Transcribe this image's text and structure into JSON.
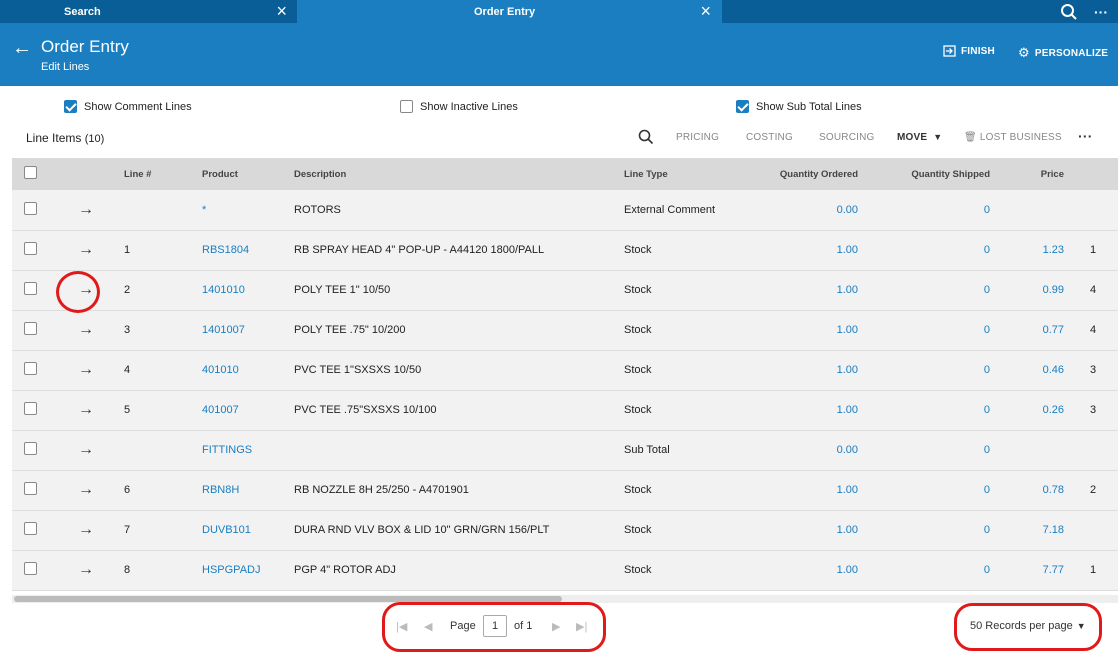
{
  "tabs": [
    {
      "label": "Search"
    },
    {
      "label": "Order Entry"
    }
  ],
  "header": {
    "title": "Order Entry",
    "subtitle": "Edit Lines",
    "finish_label": "FINISH",
    "personalize_label": "PERSONALIZE"
  },
  "options": {
    "comment": {
      "label": "Show Comment Lines",
      "checked": true
    },
    "inactive": {
      "label": "Show Inactive Lines",
      "checked": false
    },
    "subtotal": {
      "label": "Show Sub Total Lines",
      "checked": true
    }
  },
  "toolbar": {
    "title": "Line Items",
    "count": "(10)",
    "pricing": "PRICING",
    "costing": "COSTING",
    "sourcing": "SOURCING",
    "move": "MOVE",
    "lost_business": "LOST BUSINESS"
  },
  "columns": {
    "line": "Line #",
    "product": "Product",
    "description": "Description",
    "line_type": "Line Type",
    "qty_ordered": "Quantity Ordered",
    "qty_shipped": "Quantity Shipped",
    "price": "Price"
  },
  "rows": [
    {
      "line": "",
      "product": "*",
      "description": "ROTORS",
      "line_type": "External Comment",
      "qty_ordered": "0.00",
      "qty_shipped": "0",
      "price": "",
      "extra": ""
    },
    {
      "line": "1",
      "product": "RBS1804",
      "description": "RB SPRAY HEAD 4\" POP-UP - A44120 1800/PALL",
      "line_type": "Stock",
      "qty_ordered": "1.00",
      "qty_shipped": "0",
      "price": "1.23",
      "extra": "1"
    },
    {
      "line": "2",
      "product": "1401010",
      "description": "POLY TEE 1\" 10/50",
      "line_type": "Stock",
      "qty_ordered": "1.00",
      "qty_shipped": "0",
      "price": "0.99",
      "extra": "4"
    },
    {
      "line": "3",
      "product": "1401007",
      "description": "POLY TEE .75\" 10/200",
      "line_type": "Stock",
      "qty_ordered": "1.00",
      "qty_shipped": "0",
      "price": "0.77",
      "extra": "4"
    },
    {
      "line": "4",
      "product": "401010",
      "description": "PVC TEE 1\"SXSXS 10/50",
      "line_type": "Stock",
      "qty_ordered": "1.00",
      "qty_shipped": "0",
      "price": "0.46",
      "extra": "3"
    },
    {
      "line": "5",
      "product": "401007",
      "description": "PVC TEE .75\"SXSXS 10/100",
      "line_type": "Stock",
      "qty_ordered": "1.00",
      "qty_shipped": "0",
      "price": "0.26",
      "extra": "3"
    },
    {
      "line": "",
      "product": "FITTINGS",
      "description": "",
      "line_type": "Sub Total",
      "qty_ordered": "0.00",
      "qty_shipped": "0",
      "price": "",
      "extra": ""
    },
    {
      "line": "6",
      "product": "RBN8H",
      "description": "RB NOZZLE 8H 25/250 - A4701901",
      "line_type": "Stock",
      "qty_ordered": "1.00",
      "qty_shipped": "0",
      "price": "0.78",
      "extra": "2"
    },
    {
      "line": "7",
      "product": "DUVB101",
      "description": "DURA RND VLV BOX & LID 10\" GRN/GRN 156/PLT",
      "line_type": "Stock",
      "qty_ordered": "1.00",
      "qty_shipped": "0",
      "price": "7.18",
      "extra": ""
    },
    {
      "line": "8",
      "product": "HSPGPADJ",
      "description": "PGP 4\" ROTOR ADJ",
      "line_type": "Stock",
      "qty_ordered": "1.00",
      "qty_shipped": "0",
      "price": "7.77",
      "extra": "1"
    }
  ],
  "pager": {
    "page_label": "Page",
    "current_page": "1",
    "of_label": "of 1",
    "records_per_page": "50 Records per page"
  },
  "colors": {
    "tab_bar": "#0a5e97",
    "header": "#1a7ec0",
    "link": "#1a7ec0",
    "annotation": "#e01a1a"
  }
}
